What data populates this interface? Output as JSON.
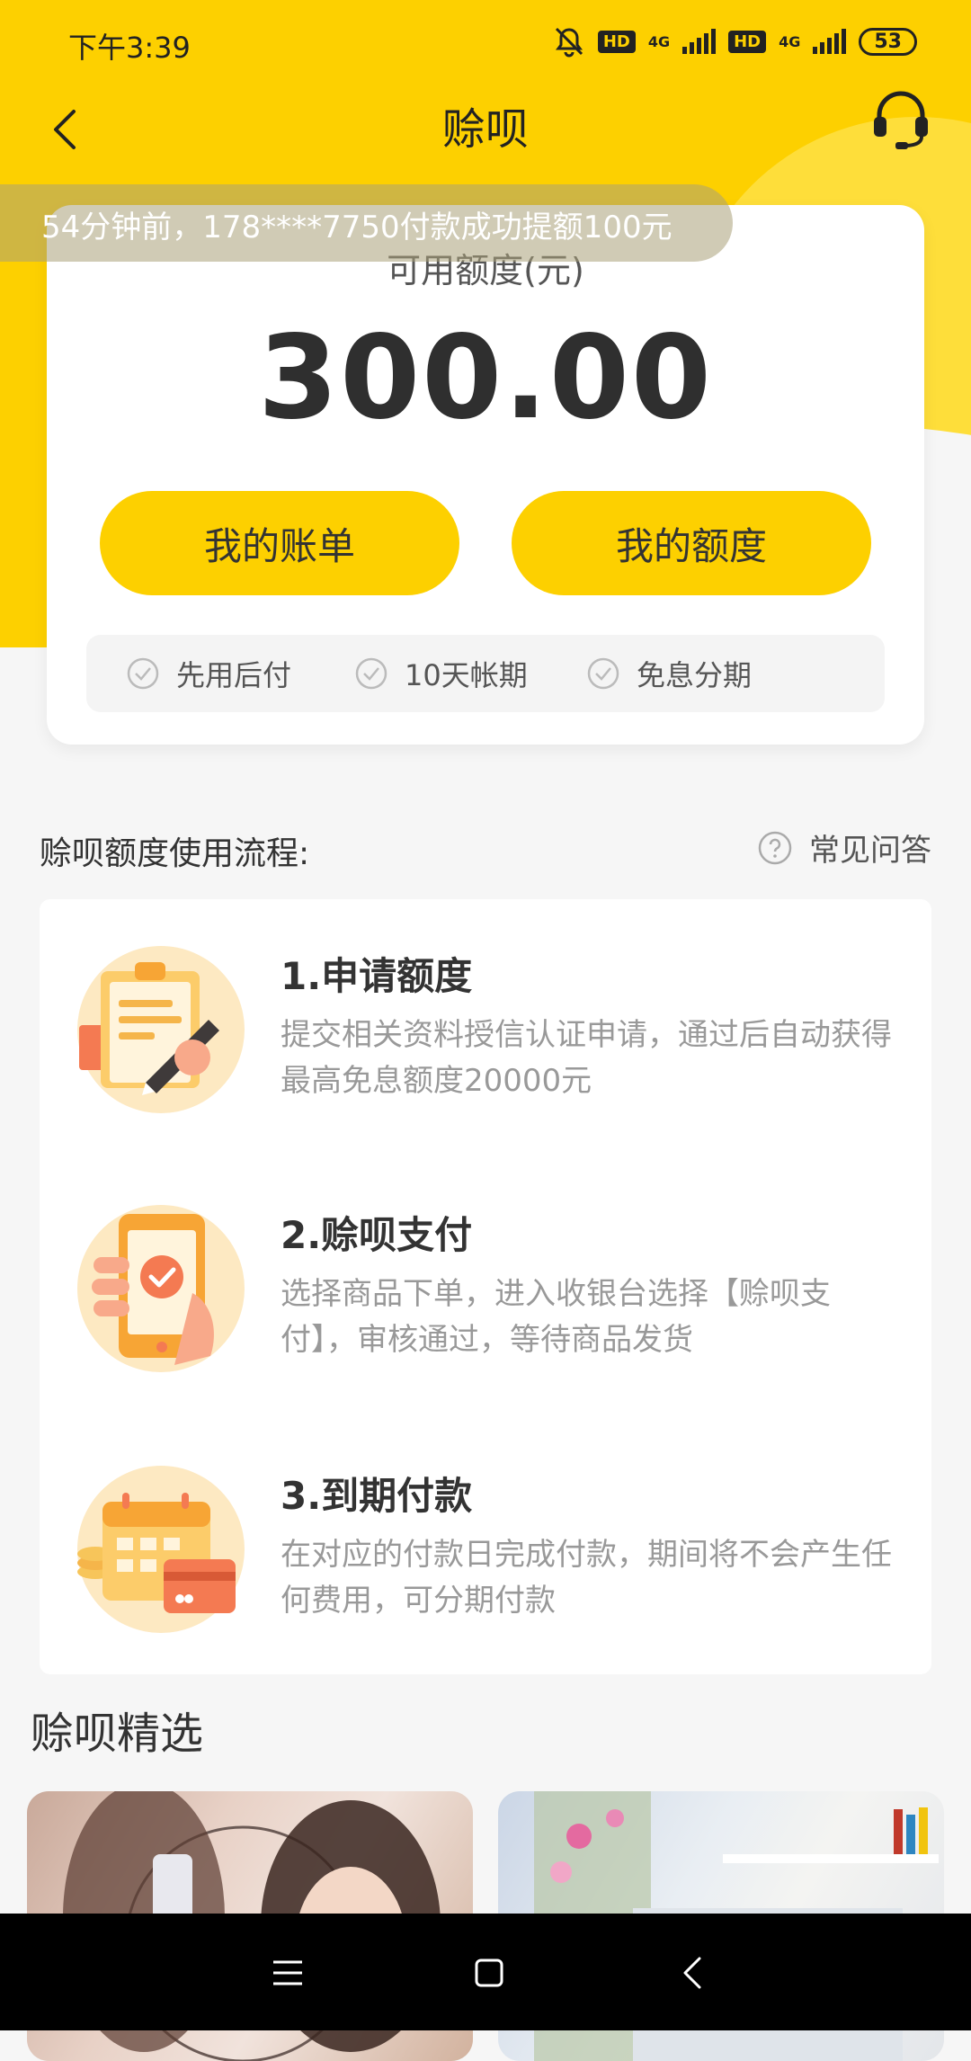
{
  "status_bar": {
    "time": "下午3:39",
    "hd1": "HD",
    "hd2": "HD",
    "net1": "4G",
    "net2": "4G",
    "battery": "53"
  },
  "header": {
    "title": "赊呗"
  },
  "ticker": {
    "text": "54分钟前，178****7750付款成功提额100元"
  },
  "credit": {
    "label": "可用额度(元)",
    "amount": "300.00",
    "btn_bill": "我的账单",
    "btn_limit": "我的额度",
    "features": [
      "先用后付",
      "10天帐期",
      "免息分期"
    ]
  },
  "process": {
    "title": "赊呗额度使用流程:",
    "faq": "常见问答",
    "steps": [
      {
        "title": "1.申请额度",
        "desc": "提交相关资料授信认证申请，通过后自动获得最高免息额度20000元",
        "icon": "clipboard-sign-icon"
      },
      {
        "title": "2.赊呗支付",
        "desc": "选择商品下单，进入收银台选择【赊呗支付】，审核通过，等待商品发货",
        "icon": "phone-pay-icon"
      },
      {
        "title": "3.到期付款",
        "desc": "在对应的付款日完成付款，期间将不会产生任何费用，可分期付款",
        "icon": "calendar-card-icon"
      }
    ]
  },
  "picks": {
    "title": "赊呗精选"
  },
  "colors": {
    "brand_yellow": "#fdd000",
    "background": "#f6f6f6",
    "text_dark": "#333333",
    "text_muted": "#999999"
  }
}
